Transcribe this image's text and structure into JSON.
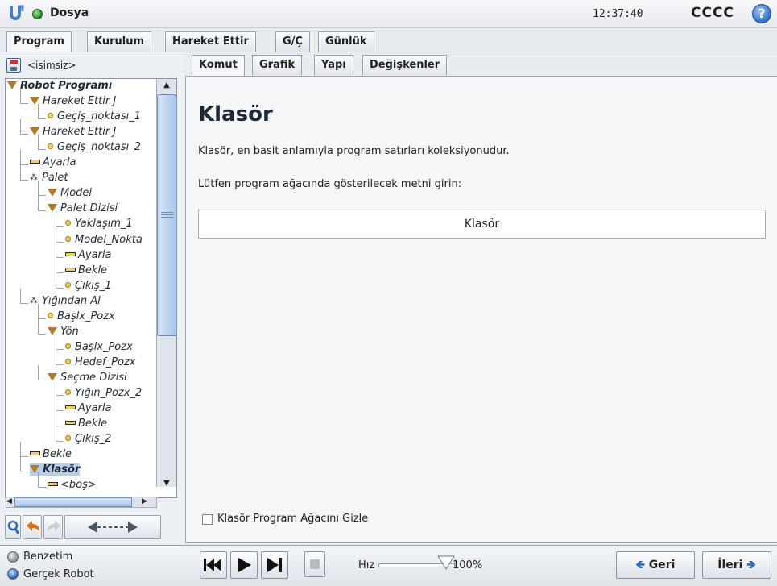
{
  "header": {
    "menu_label": "Dosya",
    "clock": "12:37:40",
    "robot_name": "CCCC",
    "help_glyph": "?"
  },
  "main_tabs": [
    {
      "label": "Program",
      "active": true
    },
    {
      "label": "Kurulum",
      "active": false
    },
    {
      "label": "Hareket Ettir",
      "active": false
    },
    {
      "label": "G/Ç",
      "active": false
    },
    {
      "label": "Günlük",
      "active": false
    }
  ],
  "program": {
    "name": "<isimsiz>"
  },
  "tree": [
    {
      "label": "Robot Programı",
      "icon": "triangle",
      "depth": 0,
      "bold": true
    },
    {
      "label": "Hareket Ettir J",
      "icon": "triangle",
      "depth": 1
    },
    {
      "label": "Geçiş_noktası_1",
      "icon": "dot",
      "depth": 2
    },
    {
      "label": "Hareket Ettir J",
      "icon": "triangle",
      "depth": 1
    },
    {
      "label": "Geçiş_noktası_2",
      "icon": "dot",
      "depth": 2
    },
    {
      "label": "Ayarla",
      "icon": "bar",
      "depth": 1
    },
    {
      "label": "Palet",
      "icon": "pallet",
      "depth": 1
    },
    {
      "label": "Model",
      "icon": "triangle",
      "depth": 2
    },
    {
      "label": "Palet Dizisi",
      "icon": "triangle",
      "depth": 2
    },
    {
      "label": "Yaklaşım_1",
      "icon": "dot",
      "depth": 3
    },
    {
      "label": "Model_Nokta",
      "icon": "dot",
      "depth": 3
    },
    {
      "label": "Ayarla",
      "icon": "bar",
      "depth": 3
    },
    {
      "label": "Bekle",
      "icon": "bar",
      "depth": 3
    },
    {
      "label": "Çıkış_1",
      "icon": "dot",
      "depth": 3
    },
    {
      "label": "Yığından Al",
      "icon": "pallet",
      "depth": 1
    },
    {
      "label": "Başlx_Pozx",
      "icon": "dot",
      "depth": 2
    },
    {
      "label": "Yön",
      "icon": "triangle",
      "depth": 2
    },
    {
      "label": "Başlx_Pozx",
      "icon": "dot",
      "depth": 3
    },
    {
      "label": "Hedef_Pozx",
      "icon": "dot",
      "depth": 3
    },
    {
      "label": "Seçme Dizisi",
      "icon": "triangle",
      "depth": 2
    },
    {
      "label": "Yığın_Pozx_2",
      "icon": "dot",
      "depth": 3
    },
    {
      "label": "Ayarla",
      "icon": "bar",
      "depth": 3
    },
    {
      "label": "Bekle",
      "icon": "bar",
      "depth": 3
    },
    {
      "label": "Çıkış_2",
      "icon": "dot",
      "depth": 3
    },
    {
      "label": "Bekle",
      "icon": "bar",
      "depth": 1
    },
    {
      "label": "Klasör",
      "icon": "triangle",
      "depth": 1,
      "bold": true,
      "selected": true
    },
    {
      "label": "<boş>",
      "icon": "bar",
      "depth": 2
    }
  ],
  "content_tabs": [
    {
      "label": "Komut",
      "active": true
    },
    {
      "label": "Grafik",
      "active": false
    },
    {
      "label": "Yapı",
      "active": false
    },
    {
      "label": "Değişkenler",
      "active": false
    }
  ],
  "content": {
    "title": "Klasör",
    "description": "Klasör, en basit anlamıyla program satırları koleksiyonudur.",
    "prompt": "Lütfen program ağacında gösterilecek metni girin:",
    "folder_name_value": "Klasör",
    "hide_checkbox_label": "Klasör Program Ağacını Gizle",
    "hide_checkbox_checked": false
  },
  "bottom": {
    "simulation_label": "Benzetim",
    "real_robot_label": "Gerçek Robot",
    "mode": "real",
    "speed_label": "Hız",
    "speed_value": "100%",
    "speed_fraction": 1.0,
    "back_label": "Geri",
    "next_label": "İleri"
  },
  "colors": {
    "accent_blue": "#2d6bc2",
    "selection": "#b7cde8",
    "node_yellow": "#f0d25a",
    "triangle_brown": "#b07a2a"
  }
}
